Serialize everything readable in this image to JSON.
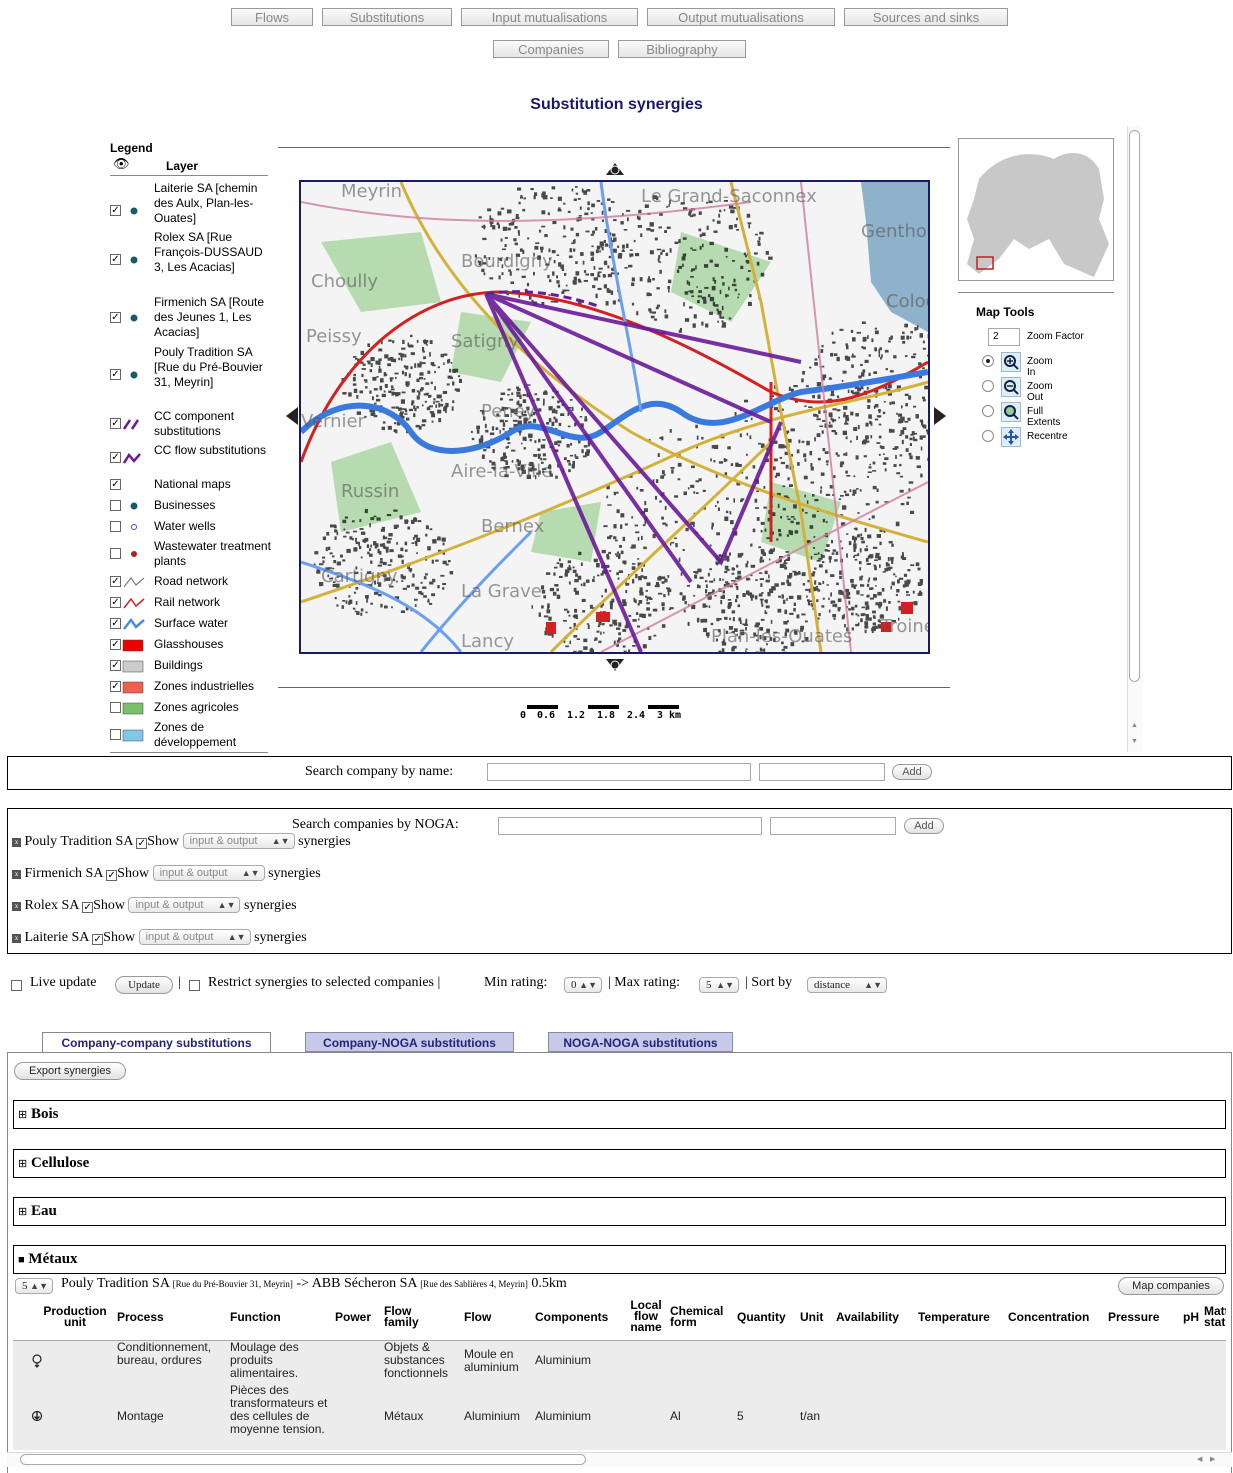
{
  "nav": {
    "row1": [
      "Flows",
      "Substitutions",
      "Input mutualisations",
      "Output mutualisations",
      "Sources and sinks"
    ],
    "row2": [
      "Companies",
      "Bibliography"
    ]
  },
  "page_title": "Substitution synergies",
  "legend": {
    "title": "Legend",
    "layer_header": "Layer",
    "items": [
      {
        "label": "Laiterie SA [chemin des Aulx, Plan-les-Ouates]",
        "checked": true,
        "icon": "teal-dot"
      },
      {
        "label": "Rolex SA [Rue François-DUSSAUD 3, Les Acacias]",
        "checked": true,
        "icon": "teal-dot"
      },
      {
        "label": "Firmenich SA [Route des Jeunes 1, Les Acacias]",
        "checked": true,
        "icon": "teal-dot"
      },
      {
        "label": "Pouly Tradition SA [Rue du Pré-Bouvier 31, Meyrin]",
        "checked": true,
        "icon": "teal-dot"
      },
      {
        "label": "CC component substitutions",
        "checked": true,
        "icon": "purple-dashed-line"
      },
      {
        "label": "CC flow substitutions",
        "checked": true,
        "icon": "purple-wave-line"
      },
      {
        "label": "National maps",
        "checked": true,
        "icon": ""
      },
      {
        "label": "Businesses",
        "checked": false,
        "icon": "teal-dot"
      },
      {
        "label": "Water wells",
        "checked": false,
        "icon": "blue-circle"
      },
      {
        "label": "Wastewater treatment plants",
        "checked": false,
        "icon": "red-dot"
      },
      {
        "label": "Road network",
        "checked": true,
        "icon": "gray-line"
      },
      {
        "label": "Rail network",
        "checked": true,
        "icon": "red-line"
      },
      {
        "label": "Surface water",
        "checked": true,
        "icon": "blue-line"
      },
      {
        "label": "Glasshouses",
        "checked": true,
        "icon": "red-box"
      },
      {
        "label": "Buildings",
        "checked": true,
        "icon": "gray-box"
      },
      {
        "label": "Zones industrielles",
        "checked": true,
        "icon": "salmon-box"
      },
      {
        "label": "Zones agricoles",
        "checked": false,
        "icon": "green-box"
      },
      {
        "label": "Zones de développement",
        "checked": false,
        "icon": "lightblue-box"
      }
    ]
  },
  "map": {
    "place_labels": [
      "Meyrin",
      "Le Grand-Saconnex",
      "Bourdigny",
      "Choully",
      "Peissy",
      "Satigny",
      "Peney",
      "Aire-la-Ville",
      "Russin",
      "Bernex",
      "Cartigny",
      "La Grave",
      "Vernier",
      "Genthod",
      "Cologny",
      "Plan-les-Ouates",
      "Troinex",
      "Lancy"
    ],
    "scale_labels": [
      "0",
      "0.6",
      "1.2",
      "1.8",
      "2.4",
      "3 km"
    ],
    "colors": {
      "frame": "#1a1a6a",
      "synergy": "#6a1a9a",
      "water": "#3a7adf",
      "rail": "#d42020",
      "road": "#d4b23a",
      "lake": "#8fb2cc"
    }
  },
  "map_tools": {
    "title": "Map Tools",
    "zoom_factor_value": "2",
    "zoom_factor_label": "Zoom Factor",
    "zoom_in": "Zoom In",
    "zoom_out": "Zoom Out",
    "full_extents": "Full Extents",
    "recentre": "Recentre"
  },
  "search_name": {
    "label": "Search company by name:",
    "value": "",
    "add": "Add"
  },
  "search_noga": {
    "label": "Search companies by NOGA:",
    "value": "",
    "add": "Add"
  },
  "companies": [
    {
      "name": "Pouly Tradition SA",
      "show": "Show",
      "mode": "input & output",
      "suffix": "synergies"
    },
    {
      "name": "Firmenich SA",
      "show": "Show",
      "mode": "input & output",
      "suffix": "synergies"
    },
    {
      "name": "Rolex SA",
      "show": "Show",
      "mode": "input & output",
      "suffix": "synergies"
    },
    {
      "name": "Laiterie SA",
      "show": "Show",
      "mode": "input & output",
      "suffix": "synergies"
    }
  ],
  "options": {
    "live_update": "Live update",
    "update_btn": "Update",
    "restrict": "Restrict synergies to selected companies |",
    "min_label": "Min rating:",
    "min_value": "0",
    "max_label": "| Max rating:",
    "max_value": "5",
    "sort_label": "| Sort by",
    "sort_value": "distance"
  },
  "tabs": [
    "Company-company substitutions",
    "Company-NOGA substitutions",
    "NOGA-NOGA substitutions"
  ],
  "export_btn": "Export synergies",
  "groups": [
    "Bois",
    "Cellulose",
    "Eau",
    "Métaux"
  ],
  "synergy": {
    "rating": "5",
    "from_name": "Pouly Tradition SA",
    "from_addr": "[Rue du Pré-Bouvier 31, Meyrin]",
    "arrow": "->",
    "to_name": "ABB Sécheron SA",
    "to_addr": "[Rue des Sablières 4, Meyrin]",
    "distance": "0.5km",
    "map_btn": "Map companies"
  },
  "table": {
    "headers": [
      "Production unit",
      "Process",
      "Function",
      "Power",
      "Flow family",
      "Flow",
      "Components",
      "Local flow name",
      "Chemical form",
      "Quantity",
      "Unit",
      "Availability",
      "Temperature",
      "Concentration",
      "Pressure",
      "pH",
      "Matt stat"
    ],
    "rows": [
      {
        "unit_icon": "output-icon",
        "process": "Conditionnement, bureau, ordures",
        "function": "Moulage des produits alimentaires.",
        "power": "",
        "family": "Objets & substances fonctionnels",
        "flow": "Moule en aluminium",
        "components": "Aluminium",
        "local": "",
        "chem": "",
        "quantity": "",
        "unit": ""
      },
      {
        "unit_icon": "input-icon",
        "process": "Montage",
        "function": "Pièces des transformateurs et des cellules de moyenne tension.",
        "power": "",
        "family": "Métaux",
        "flow": "Aluminium",
        "components": "Aluminium",
        "local": "",
        "chem": "Al",
        "quantity": "5",
        "unit": "t/an"
      }
    ]
  }
}
